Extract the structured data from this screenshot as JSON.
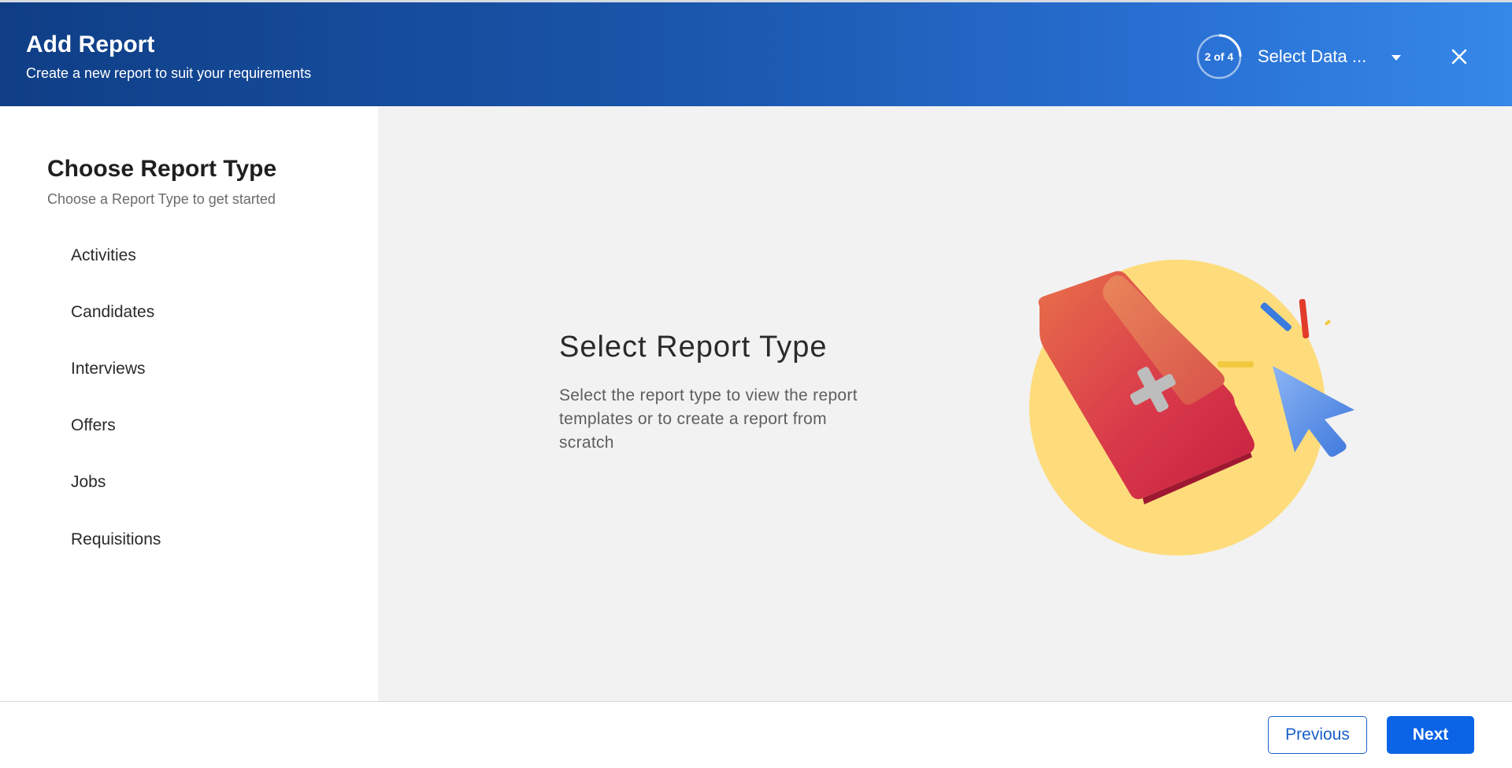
{
  "header": {
    "title": "Add Report",
    "subtitle": "Create a new report to suit your requirements",
    "step_indicator": "2 of 4",
    "step_progress": 0.5,
    "step_label": "Select Data ...",
    "close_icon": "close-icon"
  },
  "sidebar": {
    "title": "Choose Report Type",
    "subtitle": "Choose a Report Type to get started",
    "items": [
      {
        "label": "Activities"
      },
      {
        "label": "Candidates"
      },
      {
        "label": "Interviews"
      },
      {
        "label": "Offers"
      },
      {
        "label": "Jobs"
      },
      {
        "label": "Requisitions"
      }
    ]
  },
  "main": {
    "title": "Select Report Type",
    "description": "Select the report type to view the report templates or to create a report from scratch",
    "illustration_icon": "add-report-folder-illustration"
  },
  "footer": {
    "previous_label": "Previous",
    "next_label": "Next"
  },
  "colors": {
    "header_gradient_start": "#0f3e86",
    "header_gradient_end": "#3588e8",
    "primary_button": "#0b63e5",
    "main_background": "#f2f2f2"
  }
}
